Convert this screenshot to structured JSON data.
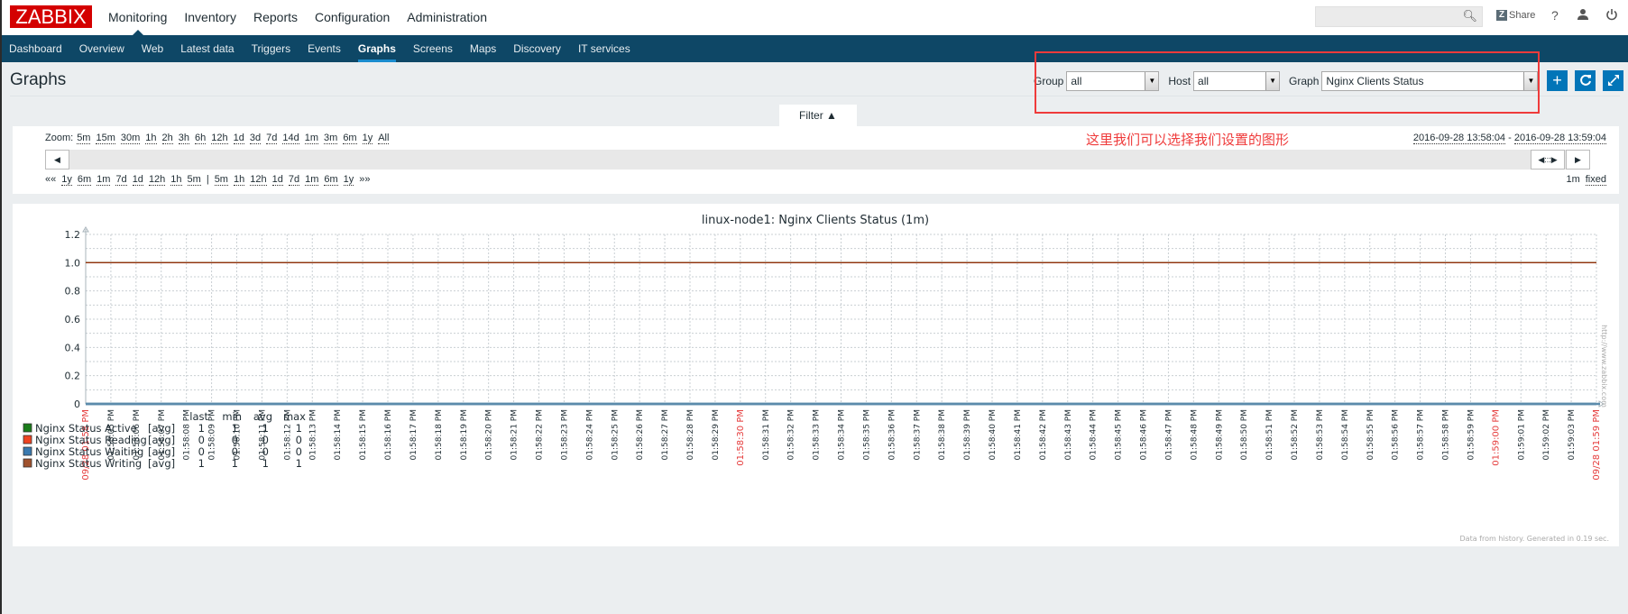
{
  "header": {
    "logo": "ZABBIX",
    "main_nav": [
      "Monitoring",
      "Inventory",
      "Reports",
      "Configuration",
      "Administration"
    ],
    "active_main": "Monitoring",
    "search_placeholder": "",
    "share_label": "Share",
    "help_label": "?"
  },
  "sub_nav": {
    "items": [
      "Dashboard",
      "Overview",
      "Web",
      "Latest data",
      "Triggers",
      "Events",
      "Graphs",
      "Screens",
      "Maps",
      "Discovery",
      "IT services"
    ],
    "active": "Graphs"
  },
  "page": {
    "title": "Graphs",
    "filters": {
      "group_label": "Group",
      "group_value": "all",
      "host_label": "Host",
      "host_value": "all",
      "graph_label": "Graph",
      "graph_value": "Nginx Clients Status"
    },
    "filter_tab": "Filter ▲",
    "annotation": "这里我们可以选择我们设置的图形"
  },
  "time_control": {
    "zoom_label": "Zoom:",
    "zoom_options": [
      "5m",
      "15m",
      "30m",
      "1h",
      "2h",
      "3h",
      "6h",
      "12h",
      "1d",
      "3d",
      "7d",
      "14d",
      "1m",
      "3m",
      "6m",
      "1y",
      "All"
    ],
    "period_from": "2016-09-28 13:58:04",
    "period_sep": " - ",
    "period_to": "2016-09-28 13:59:04",
    "nav_back_prefix": "««",
    "nav_back": [
      "1y",
      "6m",
      "1m",
      "7d",
      "1d",
      "12h",
      "1h",
      "5m"
    ],
    "nav_sep": "|",
    "nav_forward": [
      "5m",
      "1h",
      "12h",
      "1d",
      "7d",
      "1m",
      "6m",
      "1y"
    ],
    "nav_forward_suffix": "»»",
    "period_length": "1m",
    "fixed_label": "fixed"
  },
  "chart_data": {
    "type": "line",
    "title": "linux-node1: Nginx Clients Status (1m)",
    "ylim": [
      0,
      1.2
    ],
    "yticks": [
      "0",
      "0.2",
      "0.4",
      "0.6",
      "0.8",
      "1.0",
      "1.2"
    ],
    "x_start_label": "09/28 01:58 PM",
    "x_end_label": "09/28 01:59 PM",
    "x_highlight_labels": [
      "01:58:30 PM",
      "01:59:00 PM"
    ],
    "x_tick_labels": [
      "01:58:05 PM",
      "01:58:06 PM",
      "01:58:07 PM",
      "01:58:08 PM",
      "01:58:09 PM",
      "01:58:10 PM",
      "01:58:11 PM",
      "01:58:12 PM",
      "01:58:13 PM",
      "01:58:14 PM",
      "01:58:15 PM",
      "01:58:16 PM",
      "01:58:17 PM",
      "01:58:18 PM",
      "01:58:19 PM",
      "01:58:20 PM",
      "01:58:21 PM",
      "01:58:22 PM",
      "01:58:23 PM",
      "01:58:24 PM",
      "01:58:25 PM",
      "01:58:26 PM",
      "01:58:27 PM",
      "01:58:28 PM",
      "01:58:29 PM",
      "01:58:30 PM",
      "01:58:31 PM",
      "01:58:32 PM",
      "01:58:33 PM",
      "01:58:34 PM",
      "01:58:35 PM",
      "01:58:36 PM",
      "01:58:37 PM",
      "01:58:38 PM",
      "01:58:39 PM",
      "01:58:40 PM",
      "01:58:41 PM",
      "01:58:42 PM",
      "01:58:43 PM",
      "01:58:44 PM",
      "01:58:45 PM",
      "01:58:46 PM",
      "01:58:47 PM",
      "01:58:48 PM",
      "01:58:49 PM",
      "01:58:50 PM",
      "01:58:51 PM",
      "01:58:52 PM",
      "01:58:53 PM",
      "01:58:54 PM",
      "01:58:55 PM",
      "01:58:56 PM",
      "01:58:57 PM",
      "01:58:58 PM",
      "01:58:59 PM",
      "01:59:00 PM",
      "01:59:01 PM",
      "01:59:02 PM",
      "01:59:03 PM"
    ],
    "x_range_seconds": [
      0,
      60
    ],
    "grid": true,
    "legend_columns": [
      "last",
      "min",
      "avg",
      "max"
    ],
    "series": [
      {
        "name": "Nginx Status Active",
        "func": "[avg]",
        "color": "#1a7d1a",
        "last": "1",
        "min": "1",
        "avg": "1",
        "max": "1",
        "value": 1
      },
      {
        "name": "Nginx Status Reading",
        "func": "[avg]",
        "color": "#ee4422",
        "last": "0",
        "min": "0",
        "avg": "0",
        "max": "0",
        "value": 0
      },
      {
        "name": "Nginx Status Waiting",
        "func": "[avg]",
        "color": "#3a7ab0",
        "last": "0",
        "min": "0",
        "avg": "0",
        "max": "0",
        "value": 0
      },
      {
        "name": "Nginx Status Writing",
        "func": "[avg]",
        "color": "#a0522d",
        "last": "1",
        "min": "1",
        "avg": "1",
        "max": "1",
        "value": 1
      }
    ],
    "footer": "Data from history. Generated in 0.19 sec.",
    "watermark": "http://www.zabbix.com"
  }
}
